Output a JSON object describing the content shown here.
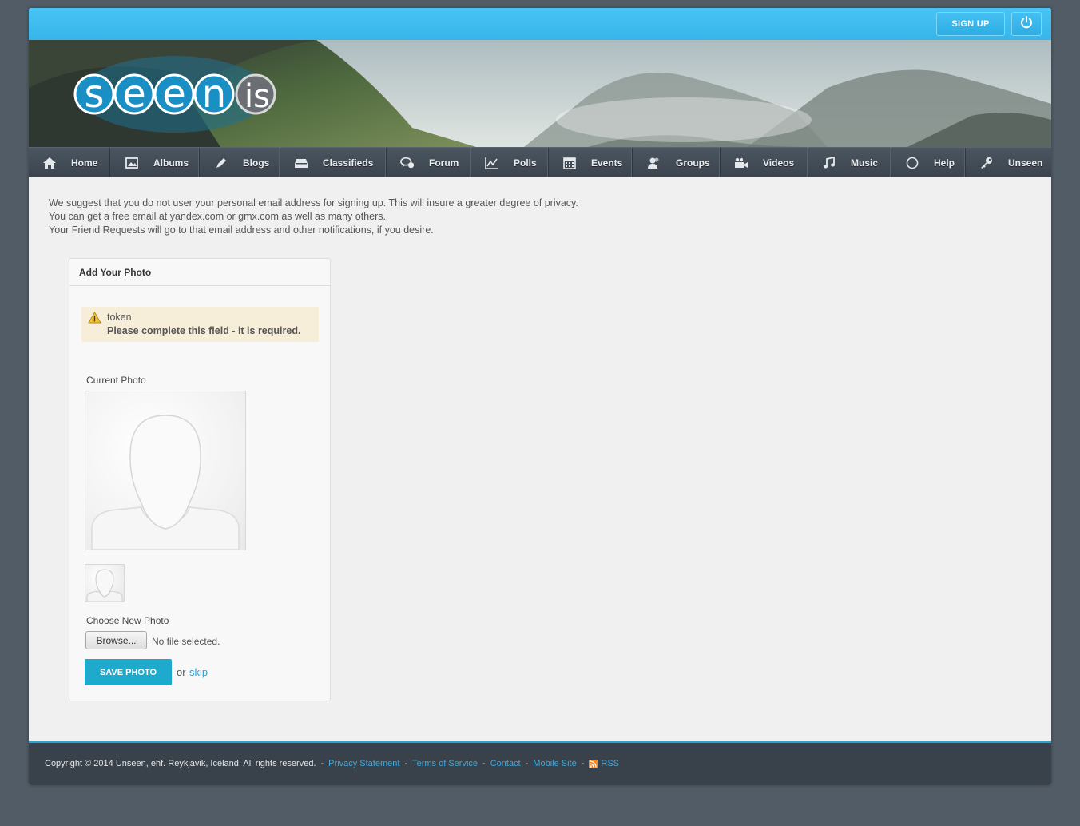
{
  "header": {
    "signup_label": "SIGN UP",
    "logo_text_main": "seen",
    "logo_text_suffix": ".is"
  },
  "nav": {
    "items": [
      {
        "label": "Home",
        "icon": "home-icon"
      },
      {
        "label": "Albums",
        "icon": "image-icon"
      },
      {
        "label": "Blogs",
        "icon": "pen-icon"
      },
      {
        "label": "Classifieds",
        "icon": "tray-icon"
      },
      {
        "label": "Forum",
        "icon": "chat-icon"
      },
      {
        "label": "Polls",
        "icon": "chart-icon"
      },
      {
        "label": "Events",
        "icon": "calendar-icon"
      },
      {
        "label": "Groups",
        "icon": "users-icon"
      },
      {
        "label": "Videos",
        "icon": "video-icon"
      },
      {
        "label": "Music",
        "icon": "music-icon"
      },
      {
        "label": "Help",
        "icon": "circle-icon"
      },
      {
        "label": "Unseen",
        "icon": "key-icon"
      }
    ]
  },
  "notice": {
    "line1": "We suggest that you do not user your personal email address for signing up. This will insure a greater degree of privacy.",
    "line2": "You can get a free email at yandex.com or gmx.com as well as many others.",
    "line3": "Your Friend Requests will go to that email address and other notifications, if you desire."
  },
  "panel": {
    "title": "Add Your Photo",
    "alert_field": "token",
    "alert_message": "Please complete this field - it is required.",
    "current_photo_label": "Current Photo",
    "choose_label": "Choose New Photo",
    "browse_label": "Browse...",
    "no_file_text": "No file selected.",
    "save_label": "SAVE PHOTO",
    "or_text": "or",
    "skip_label": "skip"
  },
  "footer": {
    "copyright": "Copyright © 2014 Unseen, ehf. Reykjavik, Iceland. All rights reserved.",
    "links": [
      "Privacy Statement",
      "Terms of Service",
      "Contact",
      "Mobile Site"
    ],
    "rss_label": "RSS"
  },
  "colors": {
    "topbar": "#3dbcf0",
    "nav_bg": "#424c56",
    "accent": "#1daacc",
    "link": "#2a9fd6",
    "footer_bg": "#39414a",
    "alert_bg": "#f6eed9"
  }
}
